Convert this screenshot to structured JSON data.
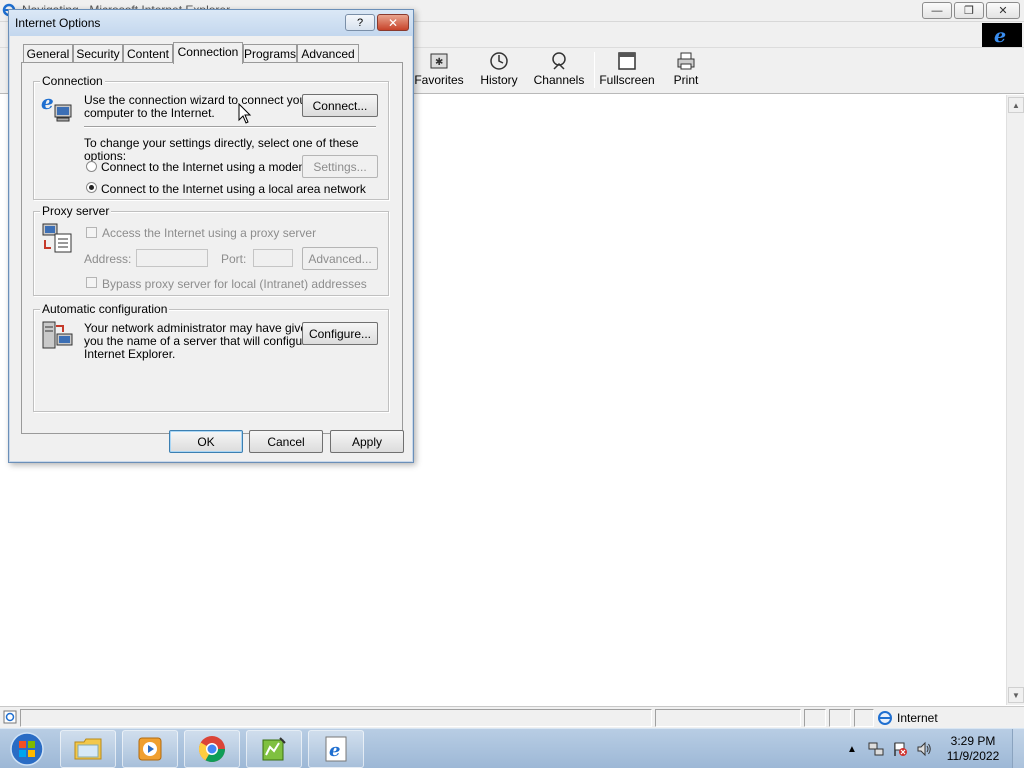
{
  "ie_window": {
    "title": "Navigating - Microsoft Internet Explorer",
    "window_buttons": {
      "minimize": "—",
      "restore": "❐",
      "close": "✕"
    },
    "toolbar": [
      {
        "label": "Favorites",
        "icon": "favorites-icon"
      },
      {
        "label": "History",
        "icon": "history-icon"
      },
      {
        "label": "Channels",
        "icon": "channels-icon"
      },
      {
        "label": "Fullscreen",
        "icon": "fullscreen-icon"
      },
      {
        "label": "Print",
        "icon": "print-icon"
      }
    ],
    "status": {
      "zone": "Internet"
    }
  },
  "dialog": {
    "title": "Internet Options",
    "help_label": "?",
    "close_label": "✕",
    "tabs": [
      "General",
      "Security",
      "Content",
      "Connection",
      "Programs",
      "Advanced"
    ],
    "active_tab": "Connection",
    "connection": {
      "group_label": "Connection",
      "wizard_text_1": "Use the connection wizard to connect your",
      "wizard_text_2": "computer to the Internet.",
      "connect_button": "Connect...",
      "change_text": "To change your settings directly, select one of these options:",
      "option_modem": "Connect to the Internet using a modem",
      "settings_button": "Settings...",
      "option_lan": "Connect to the Internet using a local area network",
      "selected_option": "lan"
    },
    "proxy": {
      "group_label": "Proxy server",
      "use_proxy": "Access the Internet using a proxy server",
      "address_label": "Address:",
      "address_value": "",
      "port_label": "Port:",
      "port_value": "",
      "advanced_button": "Advanced...",
      "bypass": "Bypass proxy server for local (Intranet) addresses"
    },
    "auto_config": {
      "group_label": "Automatic configuration",
      "text_1": "Your network administrator may have given",
      "text_2": "you the name of a server that will configure",
      "text_3": "Internet Explorer.",
      "configure_button": "Configure..."
    },
    "buttons": {
      "ok": "OK",
      "cancel": "Cancel",
      "apply": "Apply"
    }
  },
  "taskbar": {
    "clock_time": "3:29 PM",
    "clock_date": "11/9/2022"
  },
  "colors": {
    "taskbar": "#a9c2dc",
    "dialog_title": "#c3d7ee",
    "close_red": "#c7432a",
    "ie_blue": "#1f6fd0"
  }
}
